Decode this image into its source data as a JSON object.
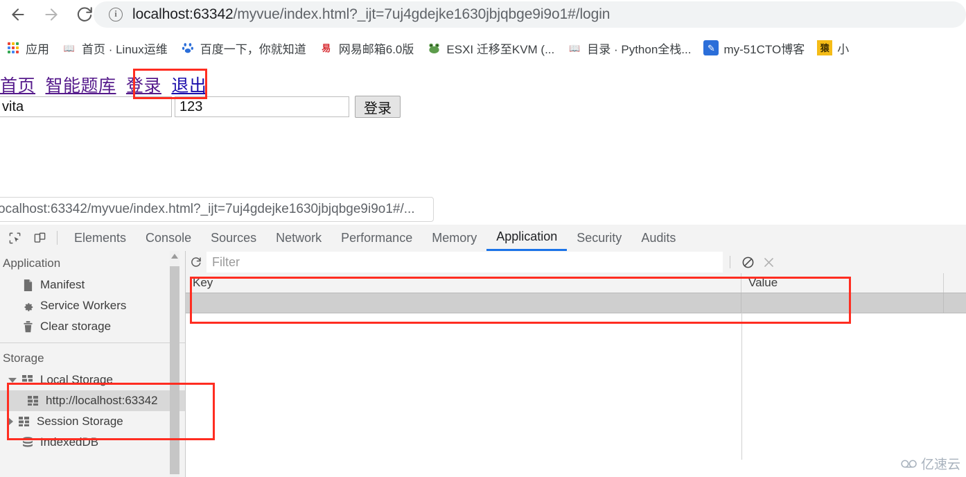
{
  "browser": {
    "back_icon": "back-arrow-icon",
    "forward_icon": "forward-arrow-icon",
    "reload_icon": "reload-icon",
    "info_icon_glyph": "i",
    "url_host": "localhost:63342",
    "url_path": "/myvue/index.html?_ijt=7uj4gdejke1630jbjqbge9i9o1#/login",
    "url_full": "localhost:63342/myvue/index.html?_ijt=7uj4gdejke1630jbjqbge9i9o1#/login"
  },
  "bookmarks": [
    {
      "label": "应用",
      "icon": "apps-grid-icon"
    },
    {
      "label": "首页 · Linux运维",
      "icon": "book-icon"
    },
    {
      "label": "百度一下，你就知道",
      "icon": "baidu-paw-icon"
    },
    {
      "label": "网易邮箱6.0版",
      "icon": "netease-mail-icon"
    },
    {
      "label": "ESXI 迁移至KVM (...",
      "icon": "frog-icon"
    },
    {
      "label": "目录 · Python全栈...",
      "icon": "book-icon"
    },
    {
      "label": "my-51CTO博客",
      "icon": "pen-icon"
    },
    {
      "label": "小",
      "icon": "yuan-icon"
    }
  ],
  "page": {
    "nav_links": [
      {
        "label": "首页",
        "state": "visited"
      },
      {
        "label": "智能题库",
        "state": "visited"
      },
      {
        "label": "登录",
        "state": "visited"
      },
      {
        "label": "退出",
        "state": "unvisited"
      }
    ],
    "username_value": "vita",
    "username_placeholder": "",
    "password_value": "123",
    "password_placeholder": "",
    "login_button": "登录"
  },
  "devtools": {
    "inspected_tab_url": "ocalhost:63342/myvue/index.html?_ijt=7uj4gdejke1630jbjqbge9i9o1#/...",
    "inspect_icon": "inspect-element-icon",
    "device_icon": "device-toolbar-icon",
    "tabs": [
      {
        "label": "Elements",
        "active": false
      },
      {
        "label": "Console",
        "active": false
      },
      {
        "label": "Sources",
        "active": false
      },
      {
        "label": "Network",
        "active": false
      },
      {
        "label": "Performance",
        "active": false
      },
      {
        "label": "Memory",
        "active": false
      },
      {
        "label": "Application",
        "active": true
      },
      {
        "label": "Security",
        "active": false
      },
      {
        "label": "Audits",
        "active": false
      }
    ],
    "active_tab": "Application",
    "accent_color": "#1a73e8",
    "sidebar": {
      "application_section": "Application",
      "application_items": [
        {
          "label": "Manifest",
          "icon": "manifest-page-icon"
        },
        {
          "label": "Service Workers",
          "icon": "gear-icon"
        },
        {
          "label": "Clear storage",
          "icon": "trash-icon"
        }
      ],
      "storage_section": "Storage",
      "storage_items": [
        {
          "label": "Local Storage",
          "icon": "storage-grid-icon",
          "expanded": true,
          "selected": false
        },
        {
          "label": "http://localhost:63342",
          "icon": "storage-grid-icon",
          "child": true,
          "selected": true
        },
        {
          "label": "Session Storage",
          "icon": "storage-grid-icon",
          "expanded": false,
          "selected": false
        },
        {
          "label": "IndexedDB",
          "icon": "database-icon",
          "selected": false
        }
      ]
    },
    "toolbar": {
      "refresh_icon": "refresh-icon",
      "filter_placeholder": "Filter",
      "clear_all_icon": "clear-all-icon",
      "delete_selected_icon": "delete-selected-icon"
    },
    "table": {
      "columns": [
        "Key",
        "Value"
      ],
      "rows": [
        {
          "Key": "",
          "Value": ""
        }
      ]
    }
  },
  "watermark": {
    "text": "亿速云",
    "color": "#a8b2bd"
  },
  "annotations": [
    {
      "name": "logout-link-highlight"
    },
    {
      "name": "storage-table-highlight"
    },
    {
      "name": "local-storage-tree-highlight"
    }
  ]
}
